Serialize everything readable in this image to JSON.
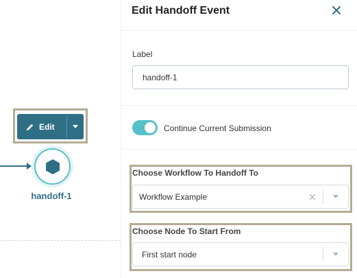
{
  "canvas": {
    "edit_button": {
      "label": "Edit"
    },
    "node": {
      "label": "handoff-1",
      "icon": "hexagon-icon"
    }
  },
  "panel": {
    "title": "Edit Handoff Event",
    "label_field": {
      "label": "Label",
      "value": "handoff-1"
    },
    "toggle": {
      "label": "Continue Current Submission",
      "checked": true
    },
    "workflow_select": {
      "label": "Choose Workflow To Handoff To",
      "value": "Workflow Example"
    },
    "node_select": {
      "label": "Choose Node To Start From",
      "value": "First start node"
    }
  },
  "colors": {
    "primary": "#2f6f86",
    "accent": "#57c0c8",
    "highlight_outline": "#b5ab95"
  }
}
